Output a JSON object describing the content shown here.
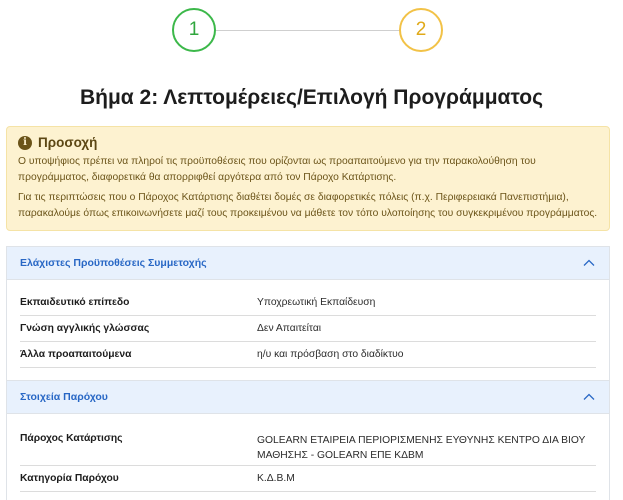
{
  "stepper": {
    "steps": [
      {
        "number": "1",
        "status": "completed",
        "color": "#3cb84a"
      },
      {
        "number": "2",
        "status": "current",
        "color": "#f2c247"
      }
    ]
  },
  "title": "Βήμα 2: Λεπτομέρειες/Επιλογή Προγράμματος",
  "alert": {
    "icon": "info-icon",
    "title": "Προσοχή",
    "paragraph1": "Ο υποψήφιος πρέπει να πληροί τις προϋποθέσεις που ορίζονται ως προαπαιτούμενο για την παρακολούθηση του προγράμματος, διαφορετικά θα απορριφθεί αργότερα από τον Πάροχο Κατάρτισης.",
    "paragraph2": "Για τις περιπτώσεις που ο Πάροχος Κατάρτισης διαθέτει δομές σε διαφορετικές πόλεις (π.χ. Περιφερειακά Πανεπιστήμια), παρακαλούμε όπως επικοινωνήσετε μαζί τους προκειμένου να μάθετε τον τόπο υλοποίησης του συγκεκριμένου προγράμματος."
  },
  "requirements": {
    "title": "Ελάχιστες Προϋποθέσεις Συμμετοχής",
    "rows": [
      {
        "label": "Εκπαιδευτικό επίπεδο",
        "value": "Υποχρεωτική Εκπαίδευση"
      },
      {
        "label": "Γνώση αγγλικής γλώσσας",
        "value": "Δεν Απαιτείται"
      },
      {
        "label": "Άλλα προαπαιτούμενα",
        "value": "η/υ και πρόσβαση στο διαδίκτυο"
      }
    ]
  },
  "provider": {
    "title": "Στοιχεία Παρόχου",
    "rows": [
      {
        "label": "Πάροχος Κατάρτισης",
        "value": "GOLEARN ΕΤΑΙΡΕΙΑ ΠΕΡΙΟΡΙΣΜΕΝΗΣ ΕΥΘΥΝΗΣ ΚΕΝΤΡΟ ΔΙΑ ΒΙΟΥ ΜΑΘΗΣΗΣ - GOLEARN ΕΠΕ ΚΔΒΜ"
      },
      {
        "label": "Κατηγορία Παρόχου",
        "value": "Κ.Δ.Β.Μ"
      }
    ]
  },
  "colors": {
    "accent_blue": "#2867c5",
    "alert_bg": "#fdf2d0",
    "panel_header_bg": "#e8f1fd"
  }
}
